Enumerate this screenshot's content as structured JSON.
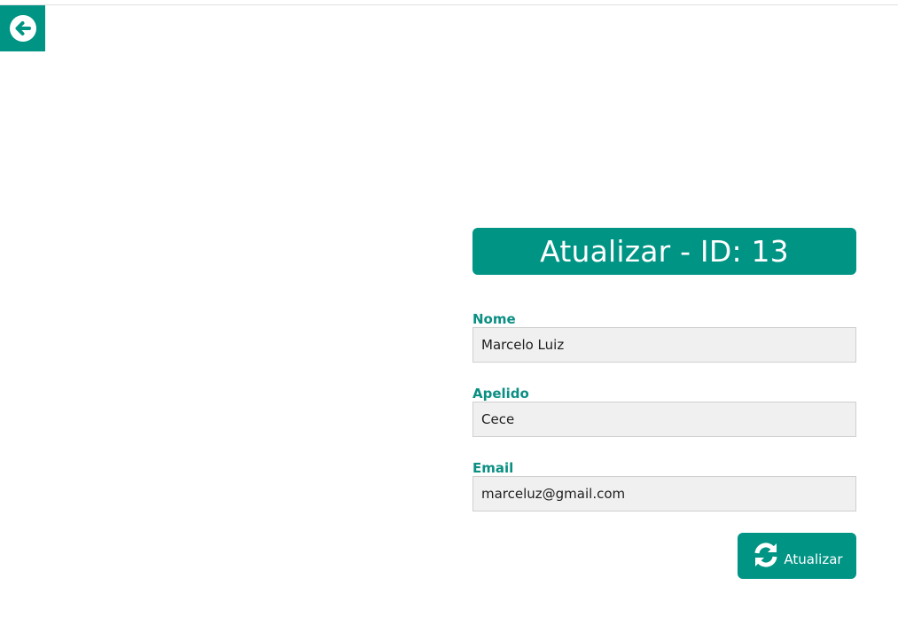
{
  "nav": {
    "back_icon": "arrow-circle-left-icon"
  },
  "form": {
    "title": "Atualizar - ID: 13",
    "fields": [
      {
        "label": "Nome",
        "value": "Marcelo Luiz"
      },
      {
        "label": "Apelido",
        "value": "Cece"
      },
      {
        "label": "Email",
        "value": "marceluz@gmail.com"
      }
    ],
    "submit_label": "Atualizar",
    "submit_icon": "refresh-icon"
  },
  "colors": {
    "accent": "#009485",
    "label": "#0b8f83",
    "input_bg": "#f0f0f0"
  }
}
